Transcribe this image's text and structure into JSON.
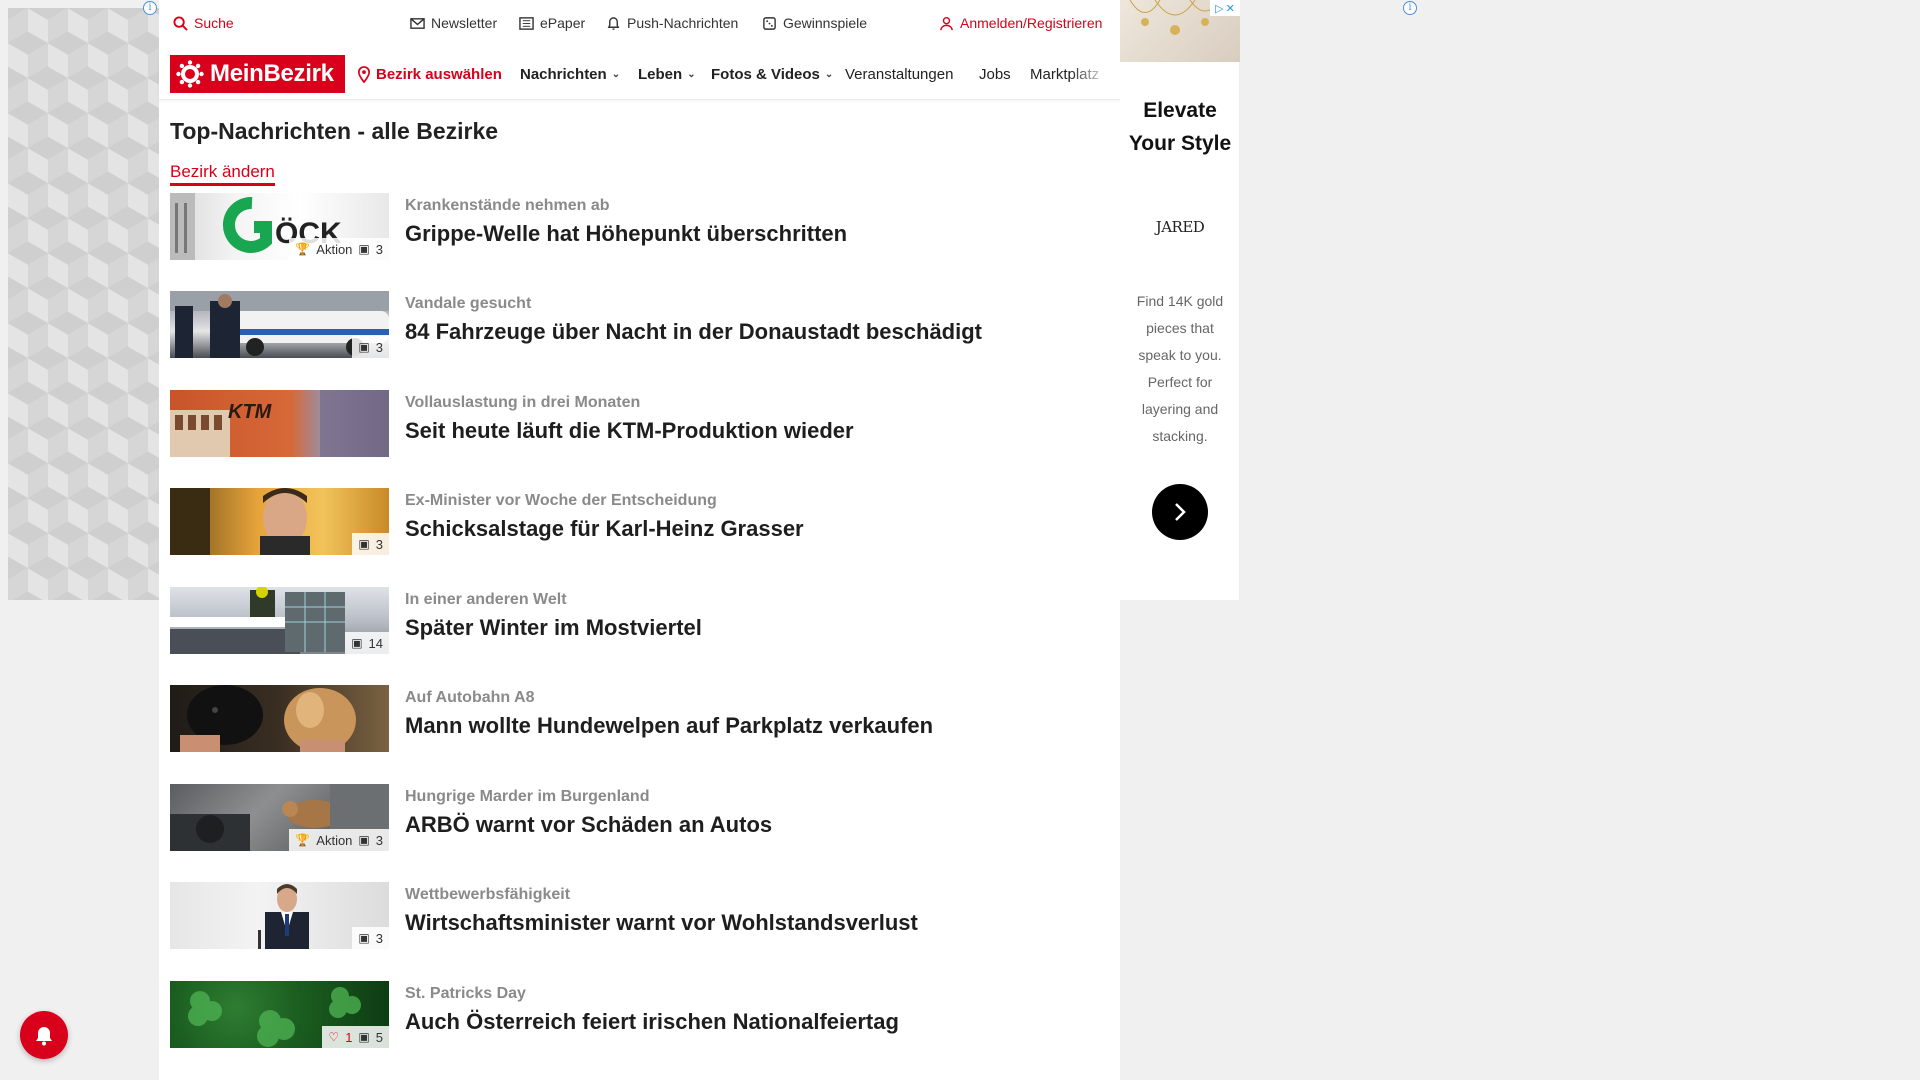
{
  "topbar": {
    "search": "Suche",
    "newsletter": "Newsletter",
    "epaper": "ePaper",
    "push": "Push-Nachrichten",
    "games": "Gewinnspiele",
    "login": "Anmelden/Registrieren"
  },
  "nav": {
    "logo": "MeinBezirk",
    "district": "Bezirk auswählen",
    "items": [
      "Nachrichten",
      "Leben",
      "Fotos & Videos",
      "Veranstaltungen",
      "Jobs",
      "Marktplatz"
    ]
  },
  "page": {
    "title": "Top-Nachrichten - alle Bezirke",
    "change_link": "Bezirk ändern"
  },
  "articles": [
    {
      "kicker": "Krankenstände nehmen ab",
      "headline": "Grippe-Welle hat Höhepunkt überschritten",
      "badge": "Aktion",
      "images": "3"
    },
    {
      "kicker": "Vandale gesucht",
      "headline": "84 Fahrzeuge über Nacht in der Donaustadt beschädigt",
      "images": "3"
    },
    {
      "kicker": "Vollauslastung in drei Monaten",
      "headline": "Seit heute läuft die KTM-Produktion wieder"
    },
    {
      "kicker": "Ex-Minister vor Woche der Entscheidung",
      "headline": "Schicksalstage für Karl-Heinz Grasser",
      "images": "3"
    },
    {
      "kicker": "In einer anderen Welt",
      "headline": "Später Winter im Mostviertel",
      "images": "14"
    },
    {
      "kicker": "Auf Autobahn A8",
      "headline": "Mann wollte Hundewelpen auf Parkplatz verkaufen"
    },
    {
      "kicker": "Hungrige Marder im Burgenland",
      "headline": "ARBÖ warnt vor Schäden an Autos",
      "badge": "Aktion",
      "images": "3"
    },
    {
      "kicker": "Wettbewerbsfähigkeit",
      "headline": "Wirtschaftsminister warnt vor Wohlstandsverlust",
      "images": "3"
    },
    {
      "kicker": "St. Patricks Day",
      "headline": "Auch Österreich feiert irischen Nationalfeiertag",
      "likes": "1",
      "images": "5"
    }
  ],
  "ad": {
    "headline": "Elevate Your Style",
    "brand": "JARED",
    "description": "Find 14K gold pieces that speak to you. Perfect for layering and stacking."
  },
  "colors": {
    "brand_red": "#d8001a"
  }
}
